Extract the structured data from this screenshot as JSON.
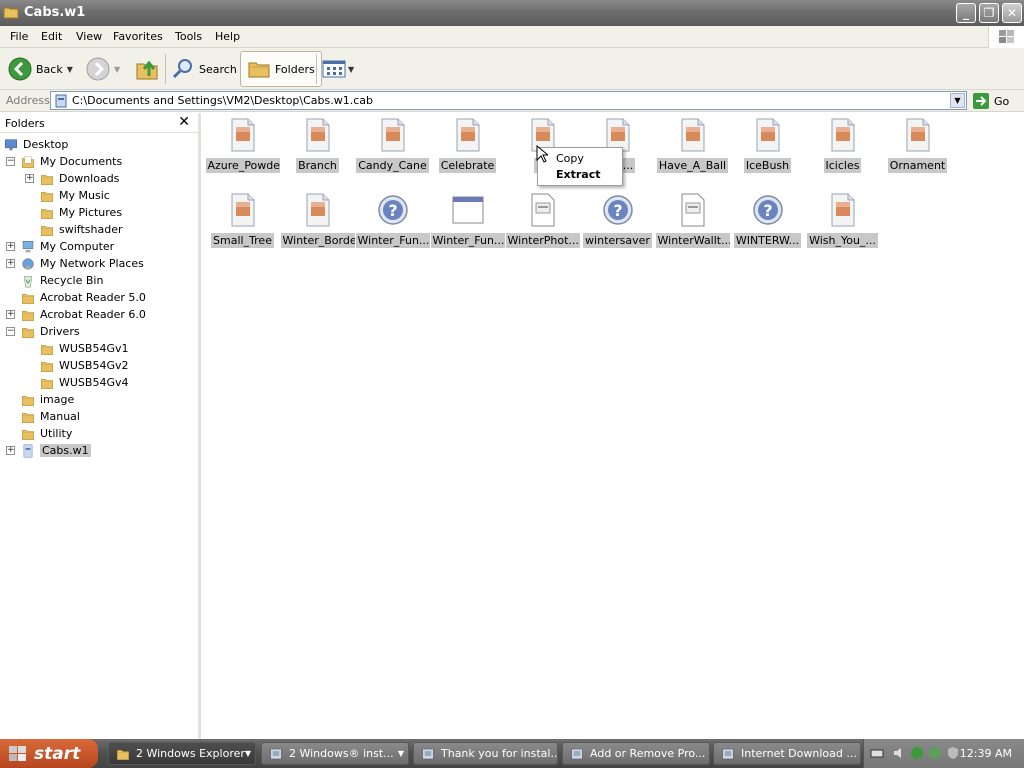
{
  "window": {
    "title": "Cabs.w1"
  },
  "menu": [
    "File",
    "Edit",
    "View",
    "Favorites",
    "Tools",
    "Help"
  ],
  "toolbar": {
    "back": "Back",
    "search": "Search",
    "folders": "Folders"
  },
  "address": {
    "label": "Address",
    "value": "C:\\Documents and Settings\\VM2\\Desktop\\Cabs.w1.cab",
    "go": "Go"
  },
  "folders_pane": {
    "title": "Folders",
    "tree": [
      {
        "label": "Desktop",
        "icon": "desktop-icon"
      },
      {
        "label": "My Documents",
        "icon": "my-documents-icon",
        "expander": "−"
      },
      {
        "label": "Downloads",
        "icon": "folder-icon",
        "expander": "+"
      },
      {
        "label": "My Music",
        "icon": "music-folder-icon"
      },
      {
        "label": "My Pictures",
        "icon": "pictures-folder-icon"
      },
      {
        "label": "swiftshader",
        "icon": "folder-icon"
      },
      {
        "label": "My Computer",
        "icon": "computer-icon",
        "expander": "+"
      },
      {
        "label": "My Network Places",
        "icon": "network-icon",
        "expander": "+"
      },
      {
        "label": "Recycle Bin",
        "icon": "recycle-bin-icon"
      },
      {
        "label": "Acrobat Reader 5.0",
        "icon": "folder-icon"
      },
      {
        "label": "Acrobat Reader 6.0",
        "icon": "folder-icon",
        "expander": "+"
      },
      {
        "label": "Drivers",
        "icon": "folder-icon",
        "expander": "−"
      },
      {
        "label": "WUSB54Gv1",
        "icon": "folder-icon"
      },
      {
        "label": "WUSB54Gv2",
        "icon": "folder-icon"
      },
      {
        "label": "WUSB54Gv4",
        "icon": "folder-icon"
      },
      {
        "label": "image",
        "icon": "folder-icon"
      },
      {
        "label": "Manual",
        "icon": "folder-icon"
      },
      {
        "label": "Utility",
        "icon": "folder-icon"
      },
      {
        "label": "Cabs.w1",
        "icon": "cab-icon",
        "expander": "+",
        "selected": true
      }
    ]
  },
  "files": [
    {
      "label": "Azure_Powder",
      "icon": "image-file-icon"
    },
    {
      "label": "Branch",
      "icon": "image-file-icon"
    },
    {
      "label": "Candy_Cane",
      "icon": "image-file-icon"
    },
    {
      "label": "Celebrate",
      "icon": "image-file-icon"
    },
    {
      "label": "Fe",
      "icon": "image-file-icon"
    },
    {
      "label": "Holi...",
      "icon": "image-file-icon"
    },
    {
      "label": "Have_A_Ball",
      "icon": "image-file-icon"
    },
    {
      "label": "IceBush",
      "icon": "image-file-icon"
    },
    {
      "label": "Icicles",
      "icon": "image-file-icon"
    },
    {
      "label": "Ornament",
      "icon": "image-file-icon"
    },
    {
      "label": "Small_Tree",
      "icon": "image-file-icon"
    },
    {
      "label": "Winter_Border",
      "icon": "image-file-icon"
    },
    {
      "label": "Winter_Fun...",
      "icon": "unknown-file-icon"
    },
    {
      "label": "Winter_Fun...",
      "icon": "window-file-icon"
    },
    {
      "label": "WinterPhot...",
      "icon": "document-file-icon"
    },
    {
      "label": "wintersaver",
      "icon": "unknown-file-icon"
    },
    {
      "label": "WinterWallt...",
      "icon": "document-file-icon"
    },
    {
      "label": "WINTERW...",
      "icon": "unknown-file-icon"
    },
    {
      "label": "Wish_You_...",
      "icon": "image-file-icon"
    }
  ],
  "context_menu": {
    "copy": "Copy",
    "extract": "Extract"
  },
  "taskbar": {
    "start": "start",
    "tasks": [
      {
        "label": "2 Windows Explorer",
        "icon": "folder-icon"
      },
      {
        "label": "2 Windows® inst...",
        "icon": "installer-icon"
      },
      {
        "label": "Thank you for instal...",
        "icon": "installer-box-icon"
      },
      {
        "label": "Add or Remove Pro...",
        "icon": "add-remove-icon"
      },
      {
        "label": "Internet Download ...",
        "icon": "download-icon"
      }
    ],
    "clock": "12:39 AM"
  }
}
